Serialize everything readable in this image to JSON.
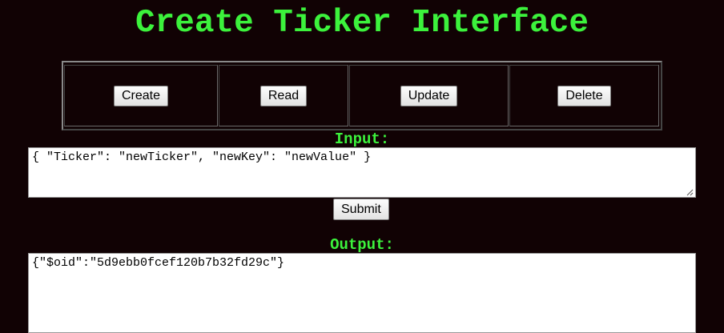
{
  "page": {
    "title": "Create Ticker Interface"
  },
  "operations": {
    "create_label": "Create",
    "read_label": "Read",
    "update_label": "Update",
    "delete_label": "Delete"
  },
  "input": {
    "label": "Input:",
    "value": "{ \"Ticker\": \"newTicker\", \"newKey\": \"newValue\" }",
    "submit_label": "Submit"
  },
  "output": {
    "label": "Output:",
    "value": "{\"$oid\":\"5d9ebb0fcef120b7b32fd29c\"}"
  },
  "colors": {
    "background": "#110204",
    "accent_green": "#3cf23c"
  }
}
